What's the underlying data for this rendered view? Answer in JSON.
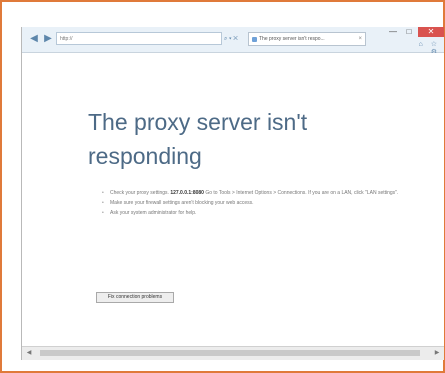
{
  "browser": {
    "address_text": "http://",
    "tab_title": "The proxy server isn't respo...",
    "nav": {
      "back": "◀",
      "forward": "▶"
    },
    "address_tools": "⌕ ▾ ✕",
    "window": {
      "min": "—",
      "max": "□",
      "close": "✕"
    },
    "toolbar": "⌂ ☆ ⚙"
  },
  "page": {
    "heading": "The proxy server isn't responding",
    "bullets": [
      {
        "prefix": "Check your proxy settings. ",
        "bold": "127.0.0.1:8080",
        "suffix": " Go to Tools > Internet Options > Connections. If you are on a LAN, click \"LAN settings\"."
      },
      {
        "text": "Make sure your firewall settings aren't blocking your web access."
      },
      {
        "text": "Ask your system administrator for help."
      }
    ],
    "diagnose_button": "Fix connection problems"
  },
  "scrollbar": {
    "left": "◀",
    "right": "▶"
  }
}
